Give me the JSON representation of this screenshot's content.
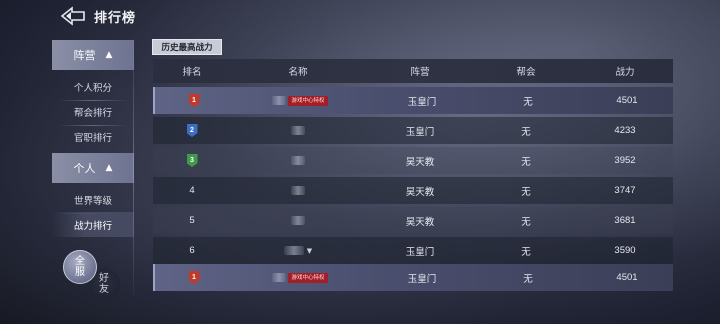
{
  "header": {
    "title": "排行榜"
  },
  "sidebar": {
    "groups": [
      {
        "label": "阵营",
        "items": [
          {
            "label": "个人积分"
          },
          {
            "label": "帮会排行"
          },
          {
            "label": "官职排行"
          }
        ]
      },
      {
        "label": "个人",
        "items": [
          {
            "label": "世界等级"
          },
          {
            "label": "战力排行"
          }
        ]
      }
    ],
    "active_item": "战力排行"
  },
  "bottom_buttons": {
    "server": {
      "line1": "全",
      "line2": "服"
    },
    "friends": {
      "line1": "好",
      "line2": "友"
    }
  },
  "tab": {
    "label": "历史最高战力"
  },
  "table": {
    "columns": [
      "排名",
      "名称",
      "阵营",
      "帮会",
      "战力"
    ],
    "rows": [
      {
        "rank": "1",
        "badge": "gold",
        "tag": "游戏中心特权",
        "camp": "玉皇门",
        "guild": "无",
        "power": "4501",
        "self": true
      },
      {
        "rank": "2",
        "badge": "blue",
        "tag": "",
        "camp": "玉皇门",
        "guild": "无",
        "power": "4233",
        "self": false
      },
      {
        "rank": "3",
        "badge": "green",
        "tag": "",
        "camp": "昊天教",
        "guild": "无",
        "power": "3952",
        "self": false
      },
      {
        "rank": "4",
        "badge": "",
        "tag": "",
        "camp": "昊天教",
        "guild": "无",
        "power": "3747",
        "self": false
      },
      {
        "rank": "5",
        "badge": "",
        "tag": "",
        "camp": "昊天教",
        "guild": "无",
        "power": "3681",
        "self": false
      },
      {
        "rank": "6",
        "badge": "",
        "tag": "",
        "glyph": "▼",
        "camp": "玉皇门",
        "guild": "无",
        "power": "3590",
        "self": false
      }
    ],
    "my_row": {
      "rank": "1",
      "badge": "gold",
      "tag": "游戏中心特权",
      "camp": "玉皇门",
      "guild": "无",
      "power": "4501"
    }
  },
  "colors": {
    "badge_gold": "#c0392b",
    "badge_blue": "#3b6fc2",
    "badge_green": "#3f9a4a",
    "privilege_tag": "#a21f27",
    "sidebar_active": "#6e7390"
  }
}
